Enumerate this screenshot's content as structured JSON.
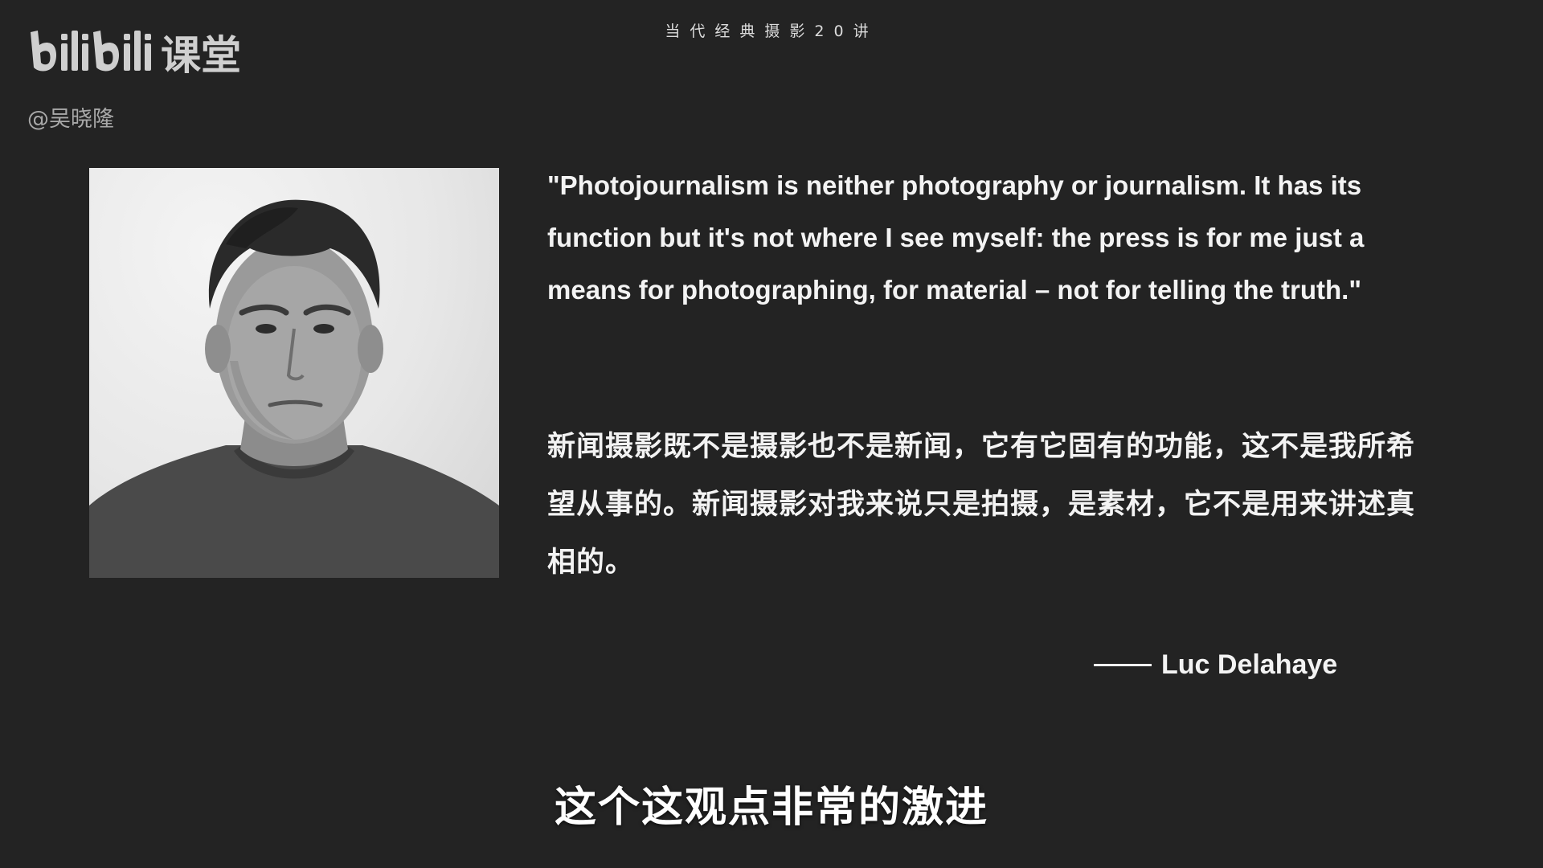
{
  "header": {
    "course_title": "当代经典摄影20讲"
  },
  "brand": {
    "logo_text": "bilibili 课堂",
    "uploader": "@吴晓隆"
  },
  "slide": {
    "portrait_alt": "Luc Delahaye portrait",
    "quote_en": "\"Photojournalism is neither photography or journalism. It has its function but it's not where I see myself: the press is for me just a means for photographing, for material – not for telling the truth.\"",
    "quote_zh": "新闻摄影既不是摄影也不是新闻，它有它固有的功能，这不是我所希望从事的。新闻摄影对我来说只是拍摄，是素材，它不是用来讲述真相的。",
    "attribution": "Luc Delahaye"
  },
  "subtitle": {
    "text": "这个这观点非常的激进"
  },
  "colors": {
    "background": "#232323",
    "text": "#f3f3f3",
    "logo": "#cfcfcf"
  }
}
